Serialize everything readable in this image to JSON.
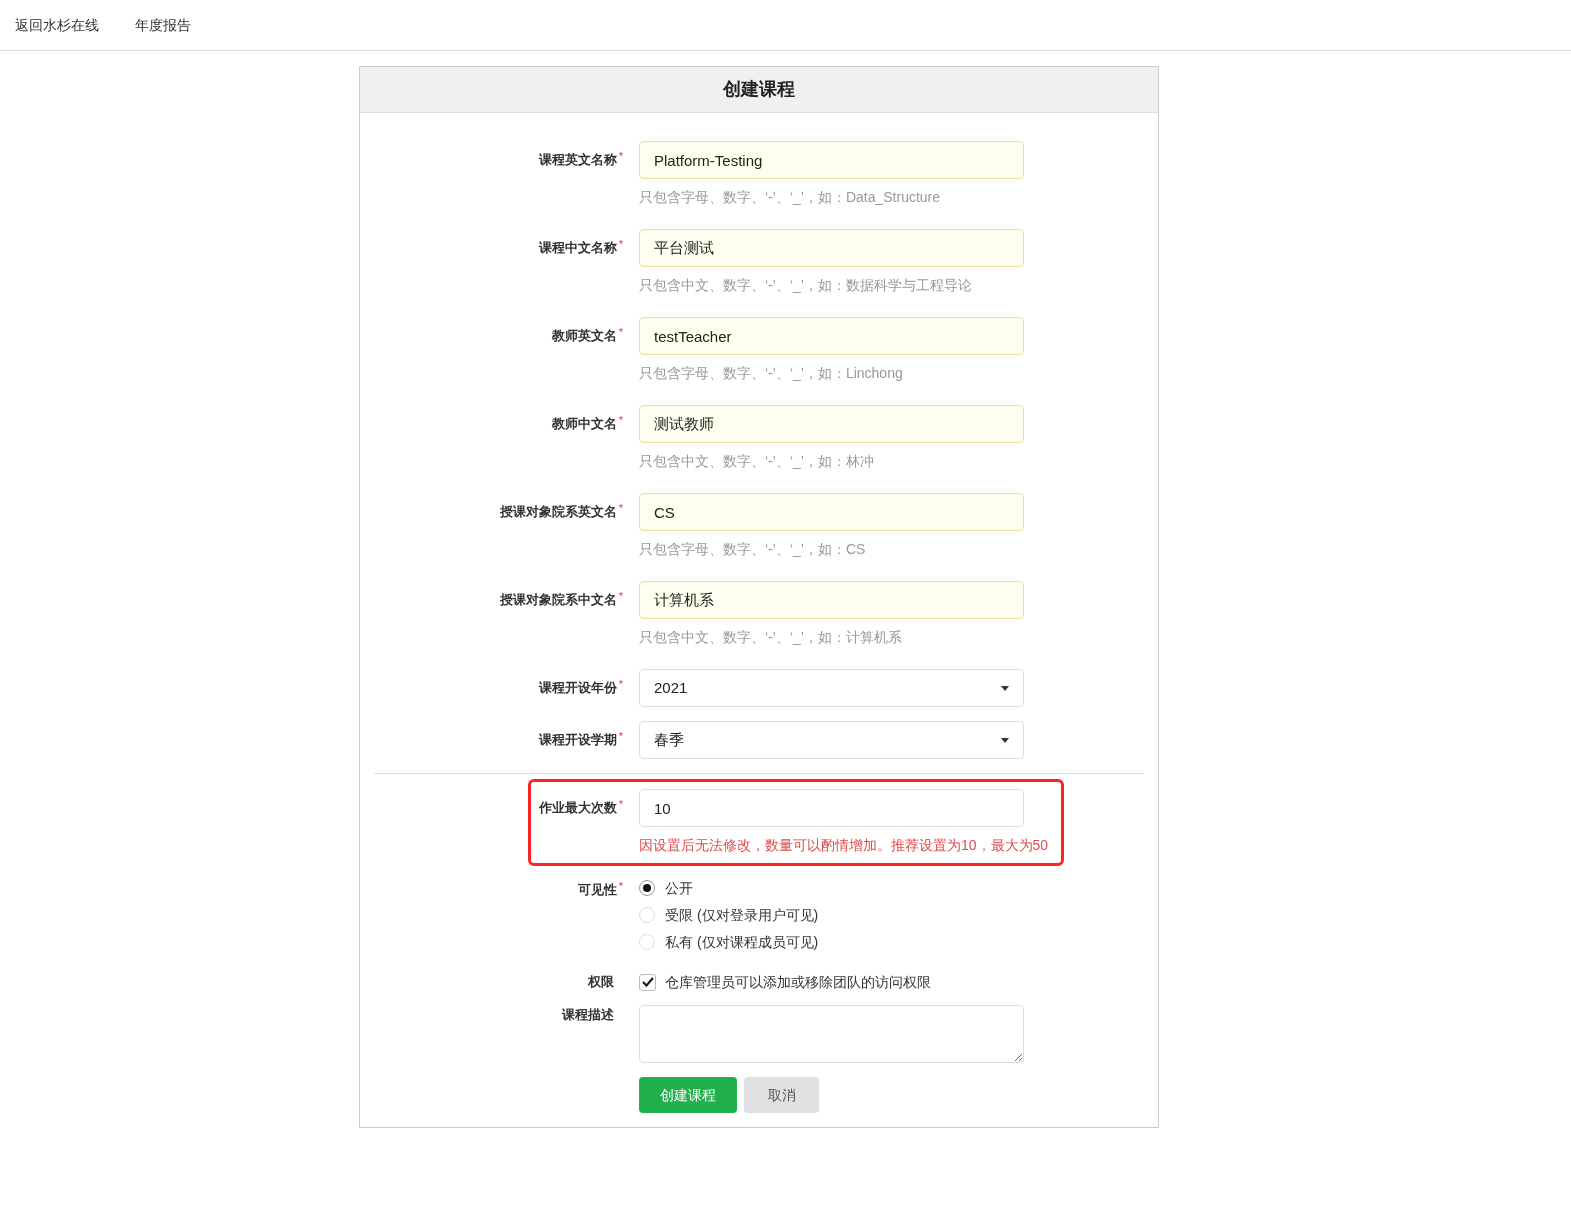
{
  "nav": {
    "links": [
      "返回水杉在线",
      "年度报告"
    ]
  },
  "card": {
    "title": "创建课程"
  },
  "fields": [
    {
      "kind": "text",
      "label": "课程英文名称",
      "required_mark": "*",
      "value": "Platform-Testing",
      "hint": "只包含字母、数字、‘-’、‘_’，如：Data_Structure"
    },
    {
      "kind": "text",
      "label": "课程中文名称",
      "required_mark": "*",
      "value": "平台测试",
      "hint": "只包含中文、数字、‘-’、‘_’，如：数据科学与工程导论"
    },
    {
      "kind": "text",
      "label": "教师英文名",
      "required_mark": "*",
      "value": "testTeacher",
      "hint": "只包含字母、数字、‘-’、‘_’，如：Linchong"
    },
    {
      "kind": "text",
      "label": "教师中文名",
      "required_mark": "*",
      "value": "测试教师",
      "hint": "只包含中文、数字、‘-’、‘_’，如：林冲"
    },
    {
      "kind": "text",
      "label": "授课对象院系英文名",
      "required_mark": "*",
      "value": "CS",
      "hint": "只包含字母、数字、‘-’、‘_’，如：CS"
    },
    {
      "kind": "text",
      "label": "授课对象院系中文名",
      "required_mark": "*",
      "value": "计算机系",
      "hint": "只包含中文、数字、‘-’、‘_’，如：计算机系"
    },
    {
      "kind": "select",
      "label": "课程开设年份",
      "required_mark": "*",
      "value": "2021"
    },
    {
      "kind": "select",
      "label": "课程开设学期",
      "required_mark": "*",
      "value": "春季"
    },
    {
      "kind": "divider"
    },
    {
      "kind": "number",
      "label": "作业最大次数",
      "required_mark": "*",
      "value": "10",
      "warning": "因设置后无法修改，数量可以酌情增加。推荐设置为10，最大为50",
      "highlighted": true
    },
    {
      "kind": "radio",
      "label": "可见性",
      "required_mark": "*",
      "options": [
        {
          "label": "公开",
          "selected": true
        },
        {
          "label": "受限 (仅对登录用户可见)",
          "selected": false
        },
        {
          "label": "私有 (仅对课程成员可见)",
          "selected": false
        }
      ]
    },
    {
      "kind": "checkbox",
      "label": "权限",
      "text": "仓库管理员可以添加或移除团队的访问权限",
      "checked": true
    },
    {
      "kind": "textarea",
      "label": "课程描述"
    }
  ],
  "buttons": [
    {
      "kind": "primary",
      "label": "创建课程"
    },
    {
      "kind": "secondary",
      "label": "取消"
    }
  ]
}
